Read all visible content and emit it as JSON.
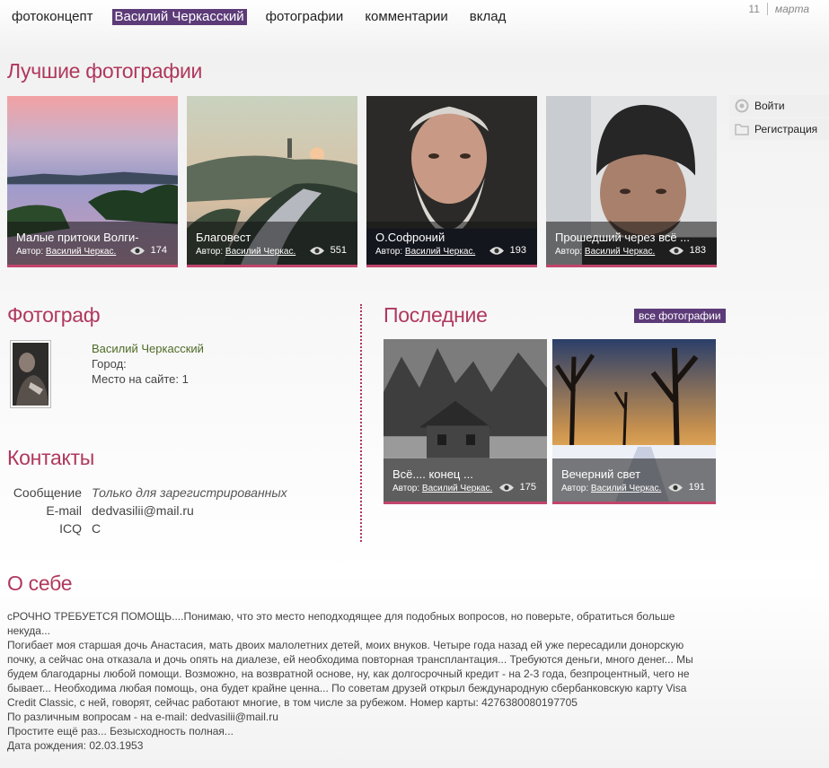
{
  "nav": {
    "items": [
      "фотоконцепт",
      "Василий Черкасский",
      "фотографии",
      "комментарии",
      "вклад"
    ],
    "active_index": 1
  },
  "date": {
    "day": "11",
    "month": "марта"
  },
  "best": {
    "title": "Лучшие фотографии",
    "author_prefix": "Автор:",
    "items": [
      {
        "title": "Малые притоки Волги-",
        "author": "Василий Черкас.",
        "views": "174"
      },
      {
        "title": "Благовест",
        "author": "Василий Черкас.",
        "views": "551"
      },
      {
        "title": "О.Софроний",
        "author": "Василий Черкас.",
        "views": "193"
      },
      {
        "title": "Прошедший через всё ...",
        "author": "Василий Черкас.",
        "views": "183"
      }
    ]
  },
  "side": {
    "login": "Войти",
    "register": "Регистрация"
  },
  "photographer": {
    "title": "Фотограф",
    "name": "Василий Черкасский",
    "city": "Город:",
    "rank": "Место на сайте: 1"
  },
  "contacts": {
    "title": "Контакты",
    "rows": [
      {
        "label": "Сообщение",
        "value": "Только для зарегистрированных"
      },
      {
        "label": "E-mail",
        "value": "dedvasilii@mail.ru"
      },
      {
        "label": "ICQ",
        "value": "С"
      }
    ]
  },
  "latest": {
    "title": "Последние",
    "all_label": "все фотографии",
    "items": [
      {
        "title": "Всё.... конец ...",
        "author": "Василий Черкас.",
        "views": "175"
      },
      {
        "title": "Вечерний свет",
        "author": "Василий Черкас.",
        "views": "191"
      }
    ]
  },
  "about": {
    "title": "О себе",
    "lines": [
      "сРОЧНО ТРЕБУЕТСЯ ПОМОЩЬ....Понимаю, что это место неподходящее для подобных вопросов, но поверьте, обратиться больше некуда...",
      "Погибает моя старшая дочь Анастасия, мать двоих малолетних детей, моих внуков. Четыре года назад ей уже пересадили донорскую почку, а сейчас она отказала и дочь опять на диалезе, ей необходима повторная трансплантация... Требуются деньги, много денег... Мы будем благодарны любой помощи. Возможно, на возвратной основе, ну, как долгосрочный кредит - на 2-3 года, безпроцентный, чего не бывает... Необходима любая помощь, она будет крайне ценна... По советам друзей открыл беждународную сбербанковскую карту Visa Credit Classic, с ней, говорят, сейчас работают многие, в том числе за рубежом. Номер карты: 4276380080197705",
      "По различным вопросам - на e-mail: dedvasilii@mail.ru",
      "Простите ещё раз... Безысходность полная...",
      "Дата рождения: 02.03.1953"
    ]
  },
  "colors": {
    "accent": "#b0385e",
    "nav_active": "#5c3b78",
    "name_green": "#4e6a26"
  }
}
